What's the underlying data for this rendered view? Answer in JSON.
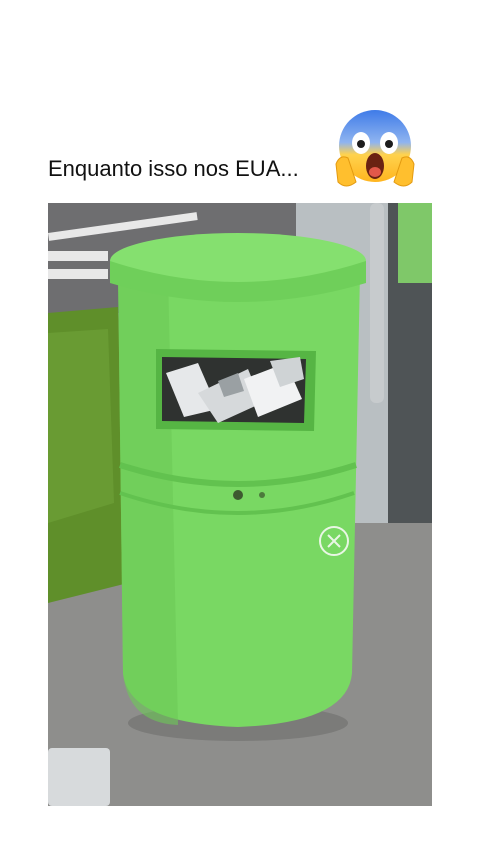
{
  "caption": {
    "text": "Enquanto isso nos EUA...",
    "emoji": "face-screaming-in-fear"
  },
  "photo": {
    "subject": "green-trash-bin-with-laptops",
    "colors": {
      "bin": "#79d863",
      "bin_shade": "#5fbf4c",
      "grass": "#5f8f2a",
      "pavement": "#8e8e8c",
      "road": "#6e6e70"
    }
  }
}
